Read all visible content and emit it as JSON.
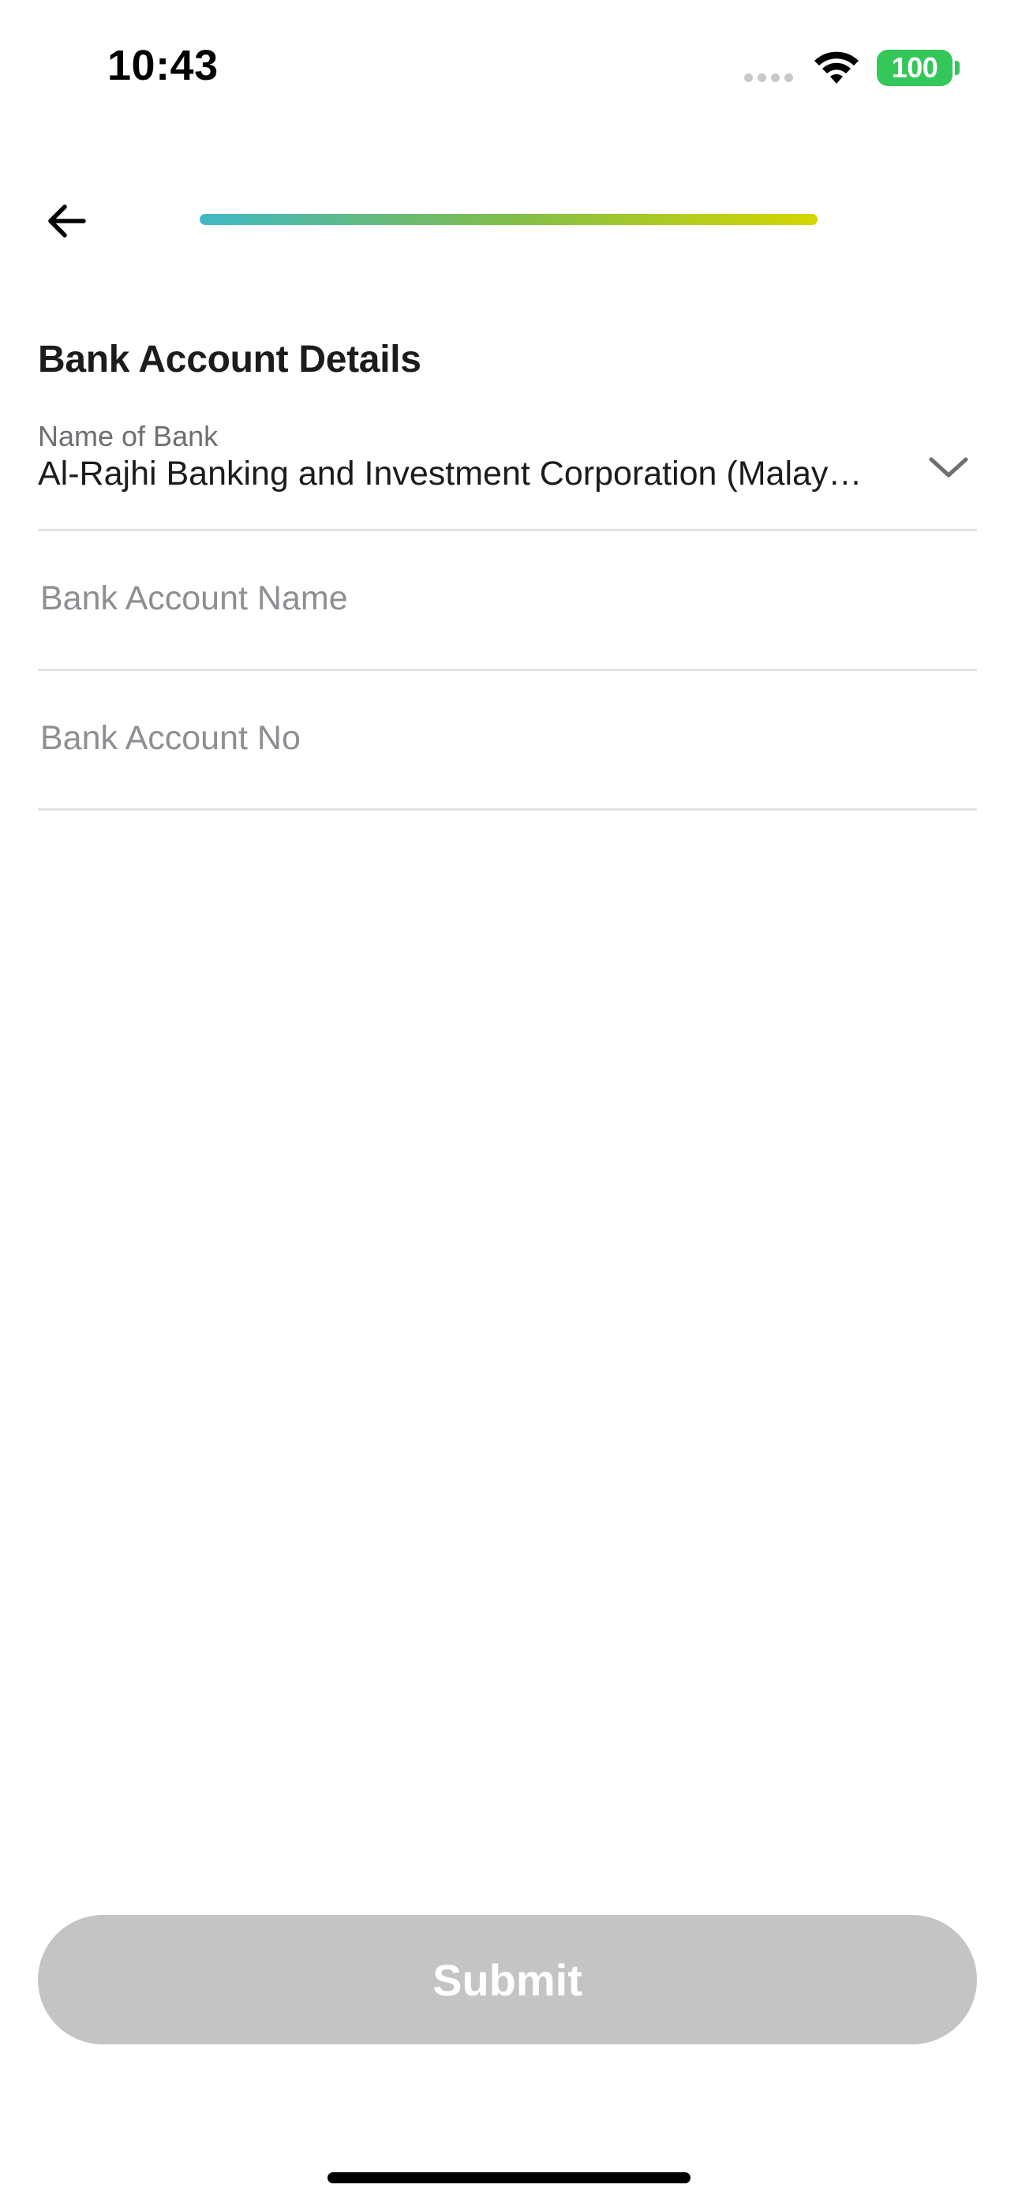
{
  "status_bar": {
    "time": "10:43",
    "battery_level": "100",
    "battery_color": "#34c759"
  },
  "header": {
    "back_icon": "arrow-left-icon",
    "progress": 1.0,
    "progress_colors": [
      "#40b8c6",
      "#7fbe4a",
      "#d6d600"
    ]
  },
  "form": {
    "title": "Bank Account Details",
    "bank_name": {
      "label": "Name of Bank",
      "value": "Al-Rajhi Banking and Investment Corporation (Malay…",
      "icon": "chevron-down-icon"
    },
    "account_name": {
      "placeholder": "Bank Account Name",
      "value": ""
    },
    "account_no": {
      "placeholder": "Bank Account No",
      "value": ""
    }
  },
  "actions": {
    "submit_label": "Submit",
    "submit_color": "#c4c4c4"
  }
}
